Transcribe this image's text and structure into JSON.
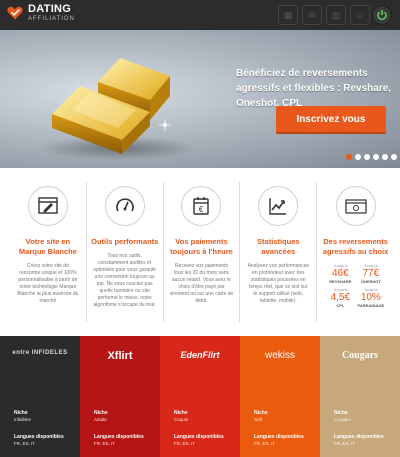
{
  "header": {
    "brand": "DATING",
    "sub": "AFFILIATION",
    "icons": [
      "grid-icon",
      "mail-icon",
      "chart-icon",
      "user-icon"
    ],
    "power_icon": "power-icon"
  },
  "hero": {
    "headline": "Bénéficiez de reversements agressifs et flexibles : Revshare, Oneshot, CPL",
    "cta_label": "Inscrivez vous",
    "slide_count": 6,
    "active_slide": 1
  },
  "features": [
    {
      "icon": "browser-edit-icon",
      "title": "Votre site en Marque Blanche",
      "text": "Créez votre site de rencontre unique et 100% personnalisable à partir de notre technologie Marque Blanche la plus avancée du marché"
    },
    {
      "icon": "speedometer-icon",
      "title": "Outils performants",
      "text": "Tous nos outils, constamment audités et optimisés pour vous garantir une conversion toujours au top. Ne vous souciez pas quelle bannière ou site performe le mieux, notre algorithme s'occupe de tout."
    },
    {
      "icon": "euro-calendar-icon",
      "title": "Vos paiements toujours à l'heure",
      "text": "Recevez vos paiements tous les 20 du mois sans aucun retard. Vous avez le choix d'être payé par virement ou sur une carte de débit."
    },
    {
      "icon": "stats-chart-icon",
      "title": "Statistiques avancées",
      "text": "Analysez vos performances en profondeur avec des statistiques poussées en temps réel, que ce soit sur le support utilisé (web, tablette, mobile)."
    },
    {
      "icon": "money-stack-icon",
      "title": "Des reversements agressifs au choix",
      "rates": [
        {
          "pre": "Jusqu'à",
          "value": "46€",
          "label": "REVSHARE"
        },
        {
          "pre": "Jusqu'à",
          "value": "77€",
          "label": "ONESHOT"
        },
        {
          "pre": "Jusqu'à",
          "value": "4,5€",
          "label": "CPL"
        },
        {
          "pre": "Jusqu'à",
          "value": "10%",
          "label": "PARRAINAGE"
        }
      ]
    }
  ],
  "sites": [
    {
      "logo": "entre INFIDELES",
      "niche_label": "Niche",
      "niche": "Infidèles",
      "lang_label": "Langues disponibles",
      "langs": "FR, ES, IT",
      "color": "#2b2b2b"
    },
    {
      "logo": "Xflirt",
      "niche_label": "Niche",
      "niche": "Adulte",
      "lang_label": "Langues disponibles",
      "langs": "FR, ES, IT",
      "color": "#b51515"
    },
    {
      "logo": "EdenFlirt",
      "niche_label": "Niche",
      "niche": "Coquin",
      "lang_label": "Langues disponibles",
      "langs": "FR, ES, IT",
      "color": "#d8281a"
    },
    {
      "logo": "wekiss",
      "niche_label": "Niche",
      "niche": "Soft",
      "lang_label": "Langues disponibles",
      "langs": "FR, ES, IT",
      "color": "#ea5b0e"
    },
    {
      "logo": "Cougars",
      "niche_label": "Niche",
      "niche": "Cougars",
      "lang_label": "Langues disponibles",
      "langs": "FR, ES, IT",
      "color": "#c7a87b"
    }
  ],
  "colors": {
    "accent": "#e8581c",
    "header": "#2c2c2c"
  }
}
